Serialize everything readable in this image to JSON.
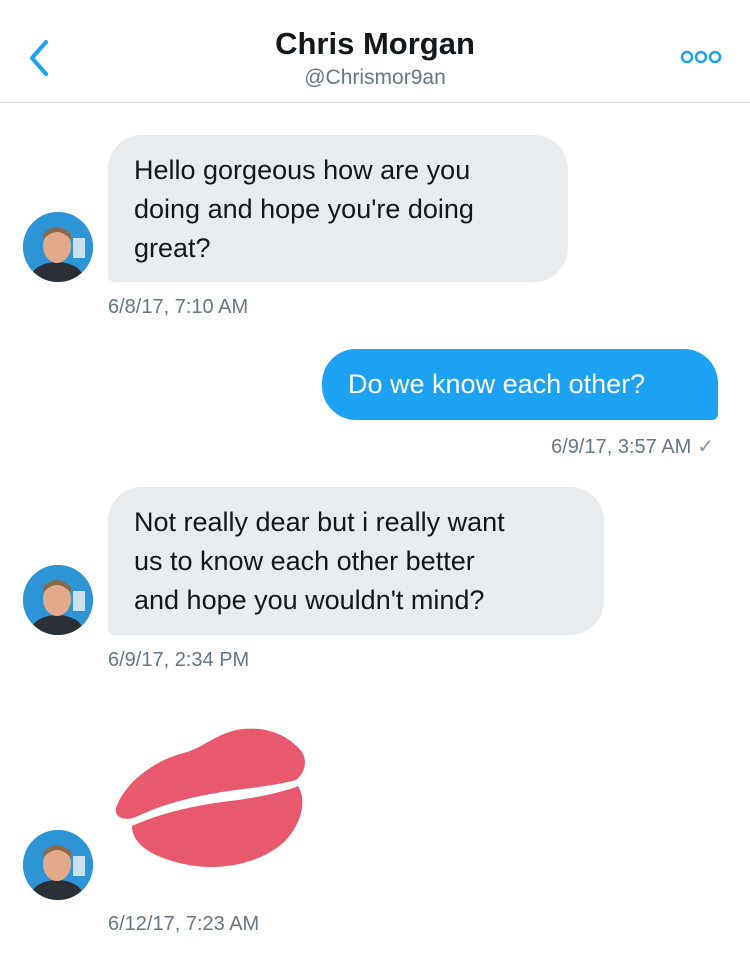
{
  "header": {
    "title": "Chris Morgan",
    "handle": "@Chrismor9an"
  },
  "messages": [
    {
      "direction": "incoming",
      "text": "Hello gorgeous how are you doing and hope you're doing great?",
      "lines": [
        "Hello gorgeous how are you",
        "doing and hope you're doing",
        "great?"
      ],
      "timestamp": "6/8/17, 7:10 AM"
    },
    {
      "direction": "outgoing",
      "text": "Do we know each other?",
      "lines": [
        "Do we know each other?"
      ],
      "timestamp": "6/9/17, 3:57 AM",
      "read_receipt": "✓"
    },
    {
      "direction": "incoming",
      "text": "Not really dear but i really want us to know each other better and hope you wouldn't mind?",
      "lines": [
        "Not really dear but i really want",
        "us to know each other better",
        "and hope you wouldn't mind?"
      ],
      "timestamp": "6/9/17, 2:34 PM"
    },
    {
      "direction": "incoming",
      "type": "emoji",
      "emoji": "kiss-mark",
      "timestamp": "6/12/17, 7:23 AM"
    }
  ],
  "colors": {
    "accent": "#1da1f2",
    "incoming_bubble": "#e6ecf0",
    "timestamp": "#657786",
    "kiss": "#e8596e"
  },
  "icons": {
    "back": "chevron-left-icon",
    "more": "more-dots-icon"
  }
}
